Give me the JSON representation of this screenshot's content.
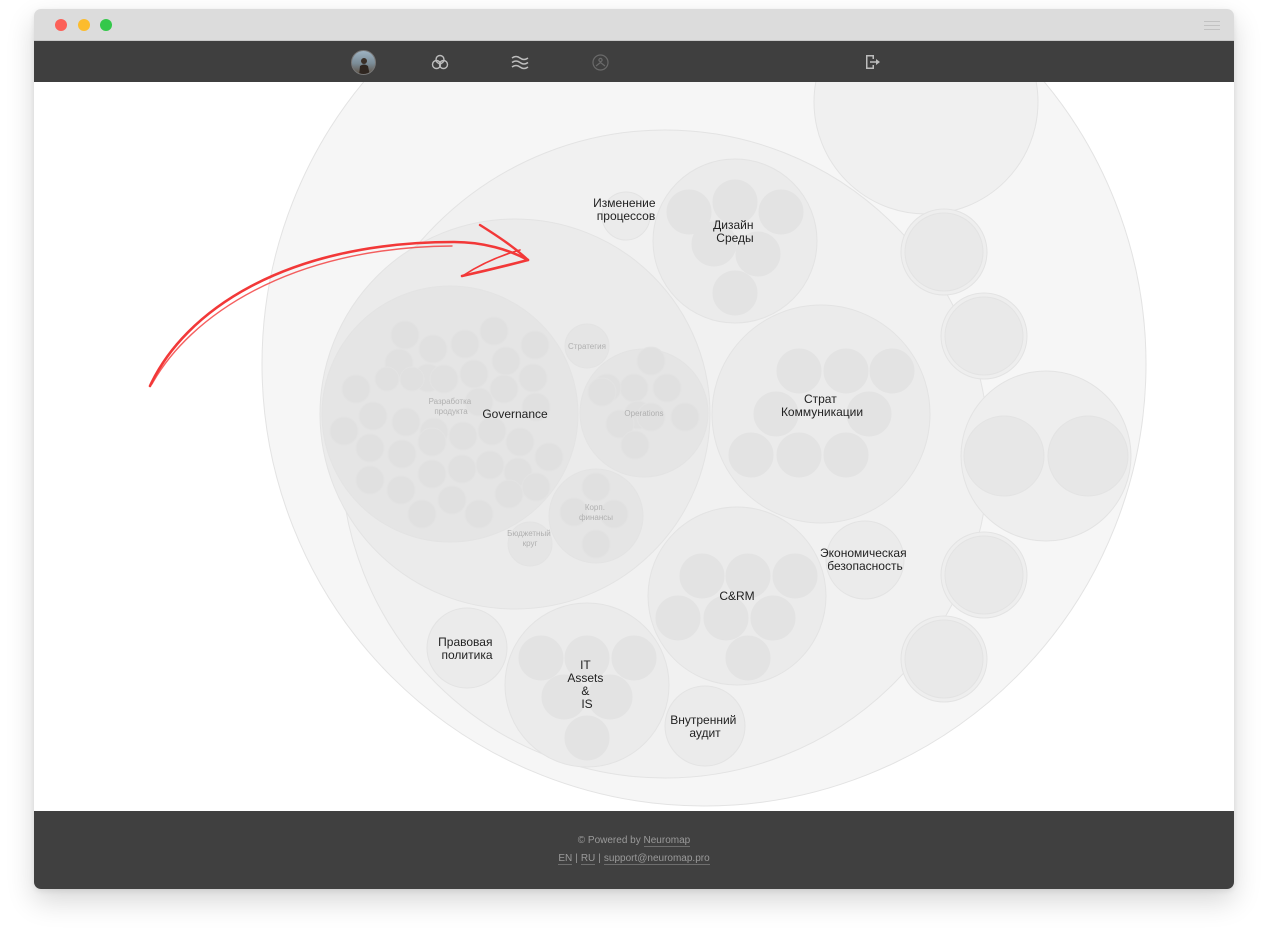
{
  "nav": {
    "icons": [
      "avatar",
      "circles-icon",
      "waves-icon",
      "people-icon",
      "logout-icon"
    ]
  },
  "circles": {
    "governance": "Governance",
    "razrabotka": "Разработка продукта",
    "strategiya": "Стратегия",
    "operations": "Operations",
    "korp_finansy": "Корп. финансы",
    "byudzhetny_krug": "Бюджетный круг",
    "izmenenie": "Изменение процессов",
    "dizain": "Дизайн Среды",
    "strat_komm": "Страт Коммуникации",
    "crm": "C&RM",
    "ekonom": "Экономическая безопасность",
    "pravovaya": "Правовая политика",
    "it_assets": "IT Assets & IS",
    "vnutrenniy": "Внутренний аудит"
  },
  "footer": {
    "powered_prefix": "© Powered by",
    "powered_link": "Neuromap",
    "lang_en": "EN",
    "lang_ru": "RU",
    "separator": "|",
    "email": "support@neuromap.pro"
  },
  "colors": {
    "nav_bg": "#3f3f3f",
    "footer_bg": "#404040",
    "circle_fill": "#f2f2f2",
    "circle_inner": "#e8e8e8",
    "arrow": "#f23838"
  }
}
